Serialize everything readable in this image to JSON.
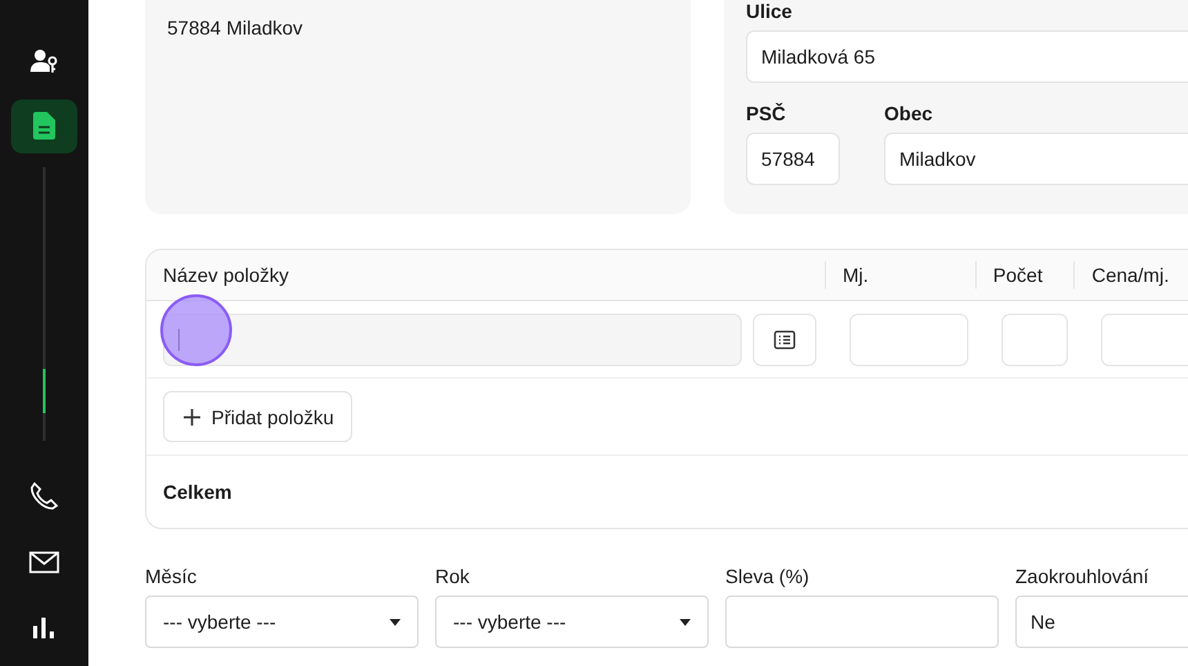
{
  "sidebar": {
    "items": [
      {
        "kind": "user-key",
        "selected": false
      },
      {
        "kind": "document",
        "selected": true
      },
      {
        "kind": "scroll"
      },
      {
        "kind": "phone",
        "selected": false
      },
      {
        "kind": "mail",
        "selected": false
      },
      {
        "kind": "chart",
        "selected": false
      }
    ]
  },
  "address_summary": {
    "text": "57884 Miladkov"
  },
  "address_form": {
    "street": {
      "label": "Ulice",
      "value": "Miladková 65"
    },
    "zip": {
      "label": "PSČ",
      "value": "57884"
    },
    "city": {
      "label": "Obec",
      "value": "Miladkov"
    }
  },
  "items_table": {
    "columns": [
      "Název položky",
      "Mj.",
      "Počet",
      "Cena/mj."
    ],
    "row": {
      "name_focused": true
    },
    "add_button": "Přidat položku",
    "total_label": "Celkem"
  },
  "filters": [
    {
      "kind": "select",
      "label": "Měsíc",
      "value": "--- vyberte ---"
    },
    {
      "kind": "select",
      "label": "Rok",
      "value": "--- vyberte ---"
    },
    {
      "kind": "input",
      "label": "Sleva (%)"
    },
    {
      "kind": "input",
      "label": "Zaokrouhlování",
      "value": "Ne"
    }
  ]
}
